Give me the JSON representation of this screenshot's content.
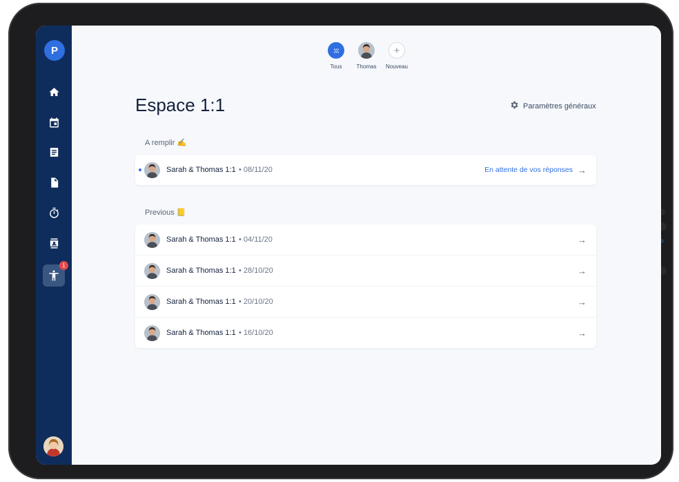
{
  "app": {
    "logo_letter": "P"
  },
  "people_switcher": [
    {
      "label": "Tous"
    },
    {
      "label": "Thomas"
    },
    {
      "label": "Nouveau"
    }
  ],
  "sidebar": {
    "badge_count": "1"
  },
  "page": {
    "title": "Espace 1:1",
    "settings_label": "Paramètres généraux"
  },
  "sections": {
    "to_fill": {
      "label": "A remplir ✍️",
      "items": [
        {
          "name": "Sarah & Thomas 1:1",
          "date": "• 08/11/20",
          "status": "En attente de vos réponses"
        }
      ]
    },
    "previous": {
      "label": "Previous 📒",
      "items": [
        {
          "name": "Sarah & Thomas 1:1",
          "date": "• 04/11/20"
        },
        {
          "name": "Sarah & Thomas 1:1",
          "date": "• 28/10/20"
        },
        {
          "name": "Sarah & Thomas 1:1",
          "date": "• 20/10/20"
        },
        {
          "name": "Sarah & Thomas 1:1",
          "date": "• 16/10/20"
        }
      ]
    }
  },
  "colors": {
    "sidebar": "#0f2d5c",
    "accent": "#2f6fe0",
    "badge": "#e5484d"
  }
}
